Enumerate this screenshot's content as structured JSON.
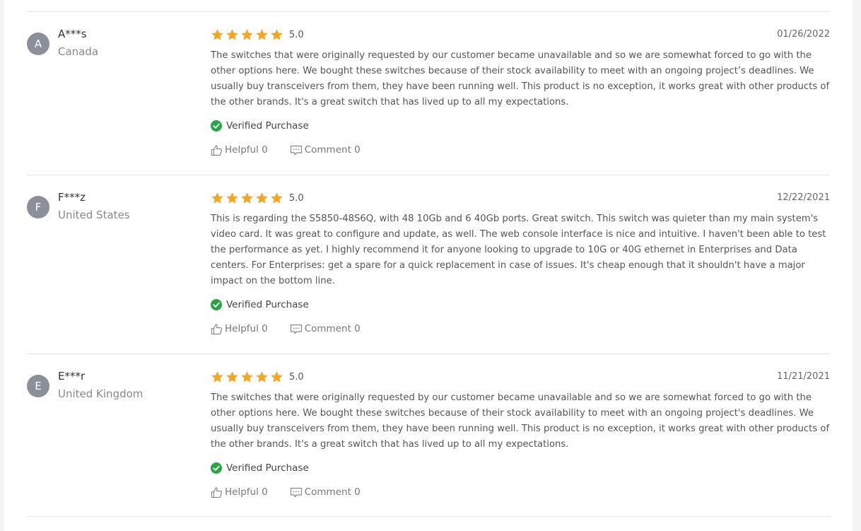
{
  "reviews": [
    {
      "initial": "A",
      "name": "A***s",
      "country": "Canada",
      "rating": "5.0",
      "stars": 5,
      "date": "01/26/2022",
      "text": "The switches that were originally requested by our customer became unavailable and so we are somewhat forced to go with the other options here. We bought these switches because of their stock availability to meet with an ongoing project’s deadlines. We usually buy transceivers from them, they have been running well. This product is no exception, it works great with other products of the other brands. It's a great switch that has lived up to all my expectations.",
      "verified": "Verified Purchase",
      "helpful": "Helpful 0",
      "comment": "Comment 0"
    },
    {
      "initial": "F",
      "name": "F***z",
      "country": "United States",
      "rating": "5.0",
      "stars": 5,
      "date": "12/22/2021",
      "text": "This is regarding the S5850-48S6Q, with 48 10Gb and 6 40Gb ports. Great switch. This switch was quieter than my main system's video card. It was great to configure and update, as well. The web console interface is nice and intuitive. I haven't been able to test the performance as yet. I highly recommend it for anyone looking to upgrade to 10G or 40G ethernet in Enterprises and Data centers. For Enterprises: get a spare for a quick replacement in case of issues. It's cheap enough that it shouldn't have a major impact on the bottom line.",
      "verified": "Verified Purchase",
      "helpful": "Helpful 0",
      "comment": "Comment 0"
    },
    {
      "initial": "E",
      "name": "E***r",
      "country": "United Kingdom",
      "rating": "5.0",
      "stars": 5,
      "date": "11/21/2021",
      "text": "The switches that were originally requested by our customer became unavailable and so we are somewhat forced to go with the other options here. We bought these switches because of their stock availability to meet with an ongoing project's deadlines. We usually buy transceivers from them, they have been running well. This product is no exception, it works great with other products of the other brands. It's a great switch that has lived up to all my expectations.",
      "verified": "Verified Purchase",
      "helpful": "Helpful 0",
      "comment": "Comment 0"
    }
  ],
  "colors": {
    "star": "#f5a623",
    "verified": "#27a744",
    "avatar": "#8a8f99",
    "action": "#777777"
  },
  "icons": {
    "star": "star-icon",
    "verified": "check-circle-icon",
    "helpful": "thumbs-up-icon",
    "comment": "comment-icon"
  }
}
